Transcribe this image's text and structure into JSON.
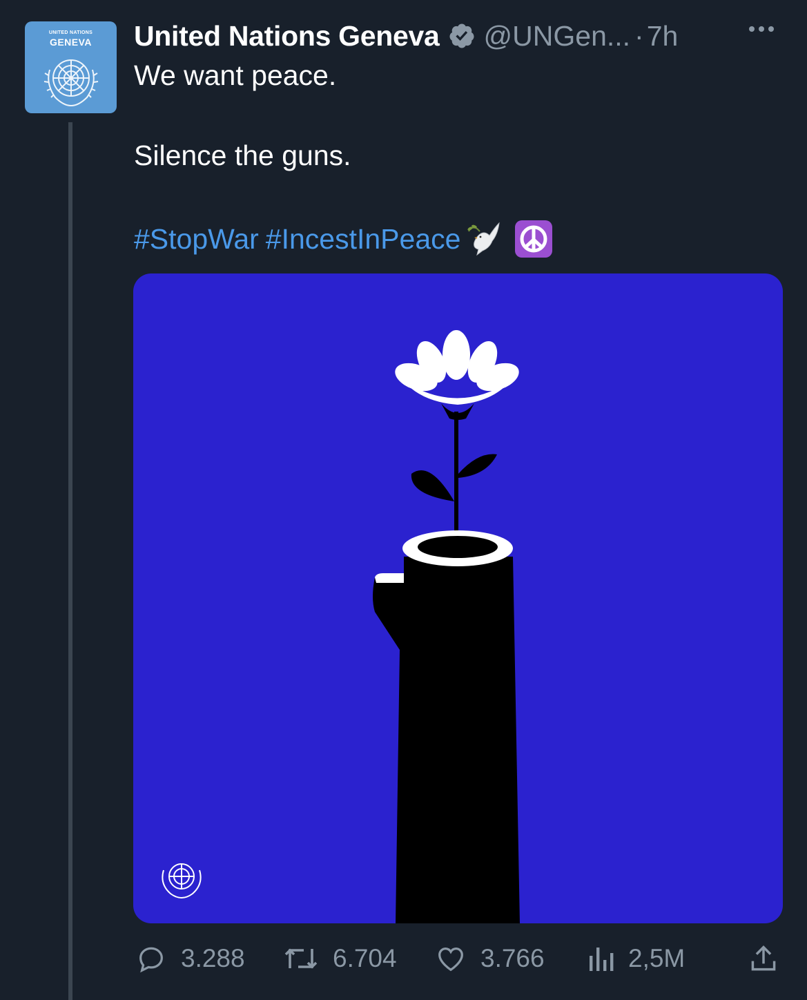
{
  "tweet": {
    "avatar": {
      "org_small": "UNITED NATIONS",
      "org_big": "GENEVA"
    },
    "author": {
      "display_name": "United Nations Geneva",
      "handle": "@UNGen...",
      "separator": "·",
      "timestamp": "7h",
      "verified_icon": "verified-badge-icon"
    },
    "text": {
      "line1": "We want peace.",
      "line2": "Silence the guns."
    },
    "hashtags": [
      "#StopWar",
      "#IncestInPeace"
    ],
    "emojis": [
      "dove-emoji",
      "peace-symbol-emoji"
    ],
    "media": {
      "background": "#2b22cf",
      "subject": "flower growing out of rifle barrel",
      "watermark": "un-emblem-icon"
    },
    "actions": {
      "replies": "3.288",
      "retweets": "6.704",
      "likes": "3.766",
      "views": "2,5M"
    }
  },
  "colors": {
    "background": "#18202b",
    "text": "#ffffff",
    "secondary_text": "#8b98a5",
    "link": "#4a99e9",
    "avatar_bg": "#5b9bd5",
    "media_bg": "#2b22cf"
  }
}
